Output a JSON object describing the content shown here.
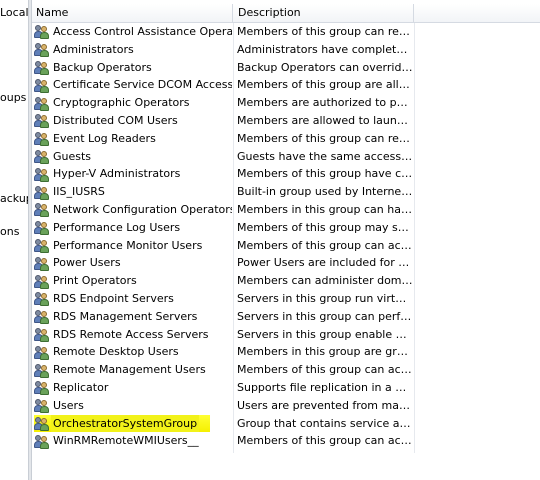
{
  "left_pane": {
    "fragments": [
      {
        "id": "local",
        "text": "Local"
      },
      {
        "id": "groups",
        "text": "oups"
      },
      {
        "id": "backup",
        "text": "ackup"
      },
      {
        "id": "ons",
        "text": "ons"
      }
    ]
  },
  "columns": {
    "name": "Name",
    "description": "Description"
  },
  "rows": [
    {
      "name": "Access Control Assistance Operators",
      "description": "Members of this group can remot...",
      "icon": "group-icon"
    },
    {
      "name": "Administrators",
      "description": "Administrators have complete an...",
      "icon": "group-icon"
    },
    {
      "name": "Backup Operators",
      "description": "Backup Operators can override se...",
      "icon": "group-icon"
    },
    {
      "name": "Certificate Service DCOM Access",
      "description": "Members of this group are allowe...",
      "icon": "group-icon"
    },
    {
      "name": "Cryptographic Operators",
      "description": "Members are authorized to perfor...",
      "icon": "group-icon"
    },
    {
      "name": "Distributed COM Users",
      "description": "Members are allowed to launch, a...",
      "icon": "group-icon"
    },
    {
      "name": "Event Log Readers",
      "description": "Members of this group can read e...",
      "icon": "group-icon"
    },
    {
      "name": "Guests",
      "description": "Guests have the same access as m...",
      "icon": "group-icon"
    },
    {
      "name": "Hyper-V Administrators",
      "description": "Members of this group have com...",
      "icon": "group-icon"
    },
    {
      "name": "IIS_IUSRS",
      "description": "Built-in group used by Internet Inf...",
      "icon": "group-icon"
    },
    {
      "name": "Network Configuration Operators",
      "description": "Members in this group can have s...",
      "icon": "group-icon"
    },
    {
      "name": "Performance Log Users",
      "description": "Members of this group may sche...",
      "icon": "group-icon"
    },
    {
      "name": "Performance Monitor Users",
      "description": "Members of this group can acces...",
      "icon": "group-icon"
    },
    {
      "name": "Power Users",
      "description": "Power Users are included for back...",
      "icon": "group-icon"
    },
    {
      "name": "Print Operators",
      "description": "Members can administer domain ...",
      "icon": "group-icon"
    },
    {
      "name": "RDS Endpoint Servers",
      "description": "Servers in this group run virtual m...",
      "icon": "group-icon"
    },
    {
      "name": "RDS Management Servers",
      "description": "Servers in this group can perform ...",
      "icon": "group-icon"
    },
    {
      "name": "RDS Remote Access Servers",
      "description": "Servers in this group enable users ...",
      "icon": "group-icon"
    },
    {
      "name": "Remote Desktop Users",
      "description": "Members in this group are grante...",
      "icon": "group-icon"
    },
    {
      "name": "Remote Management Users",
      "description": "Members of this group can acces...",
      "icon": "group-icon"
    },
    {
      "name": "Replicator",
      "description": "Supports file replication in a dom...",
      "icon": "group-icon"
    },
    {
      "name": "Users",
      "description": "Users are prevented from making ...",
      "icon": "group-icon"
    },
    {
      "name": "OrchestratorSystemGroup",
      "description": "Group that contains service accou...",
      "icon": "group-icon",
      "highlighted": true
    },
    {
      "name": "WinRMRemoteWMIUsers__",
      "description": "Members of this group can acces...",
      "icon": "group-icon"
    }
  ],
  "colors": {
    "highlight": "#f5f000",
    "header_border": "#d5dae2"
  }
}
